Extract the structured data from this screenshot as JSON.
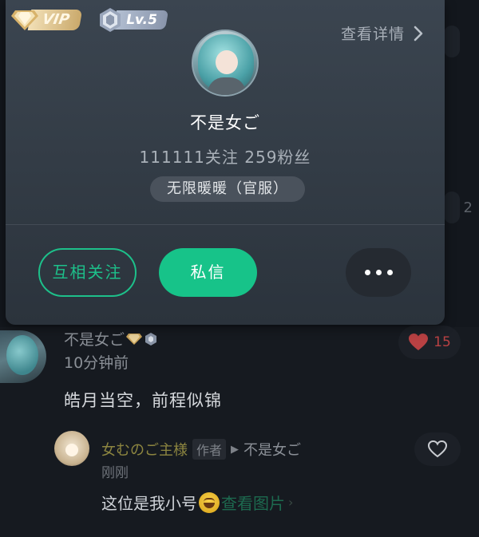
{
  "popup": {
    "vip_label": "VIP",
    "level_label": "Lv.5",
    "detail_link": "查看详情",
    "name": "不是女ご",
    "stats": "111111关注 259粉丝",
    "server_tag": "无限暖暖（官服）",
    "mutual_follow_label": "互相关注",
    "message_label": "私信"
  },
  "background": {
    "side_count": "2"
  },
  "comment": {
    "author": "不是女ご",
    "time": "10分钟前",
    "text": "皓月当空，前程似锦",
    "like_count": "15"
  },
  "reply": {
    "author": "女むのご主様",
    "author_badge": "作者",
    "reply_to": "不是女ご",
    "time": "刚刚",
    "text": "这位是我小号",
    "image_link": "查看图片"
  },
  "colors": {
    "accent_green": "#17c389",
    "like_red": "#b94143",
    "card_bg": "#333c46"
  }
}
